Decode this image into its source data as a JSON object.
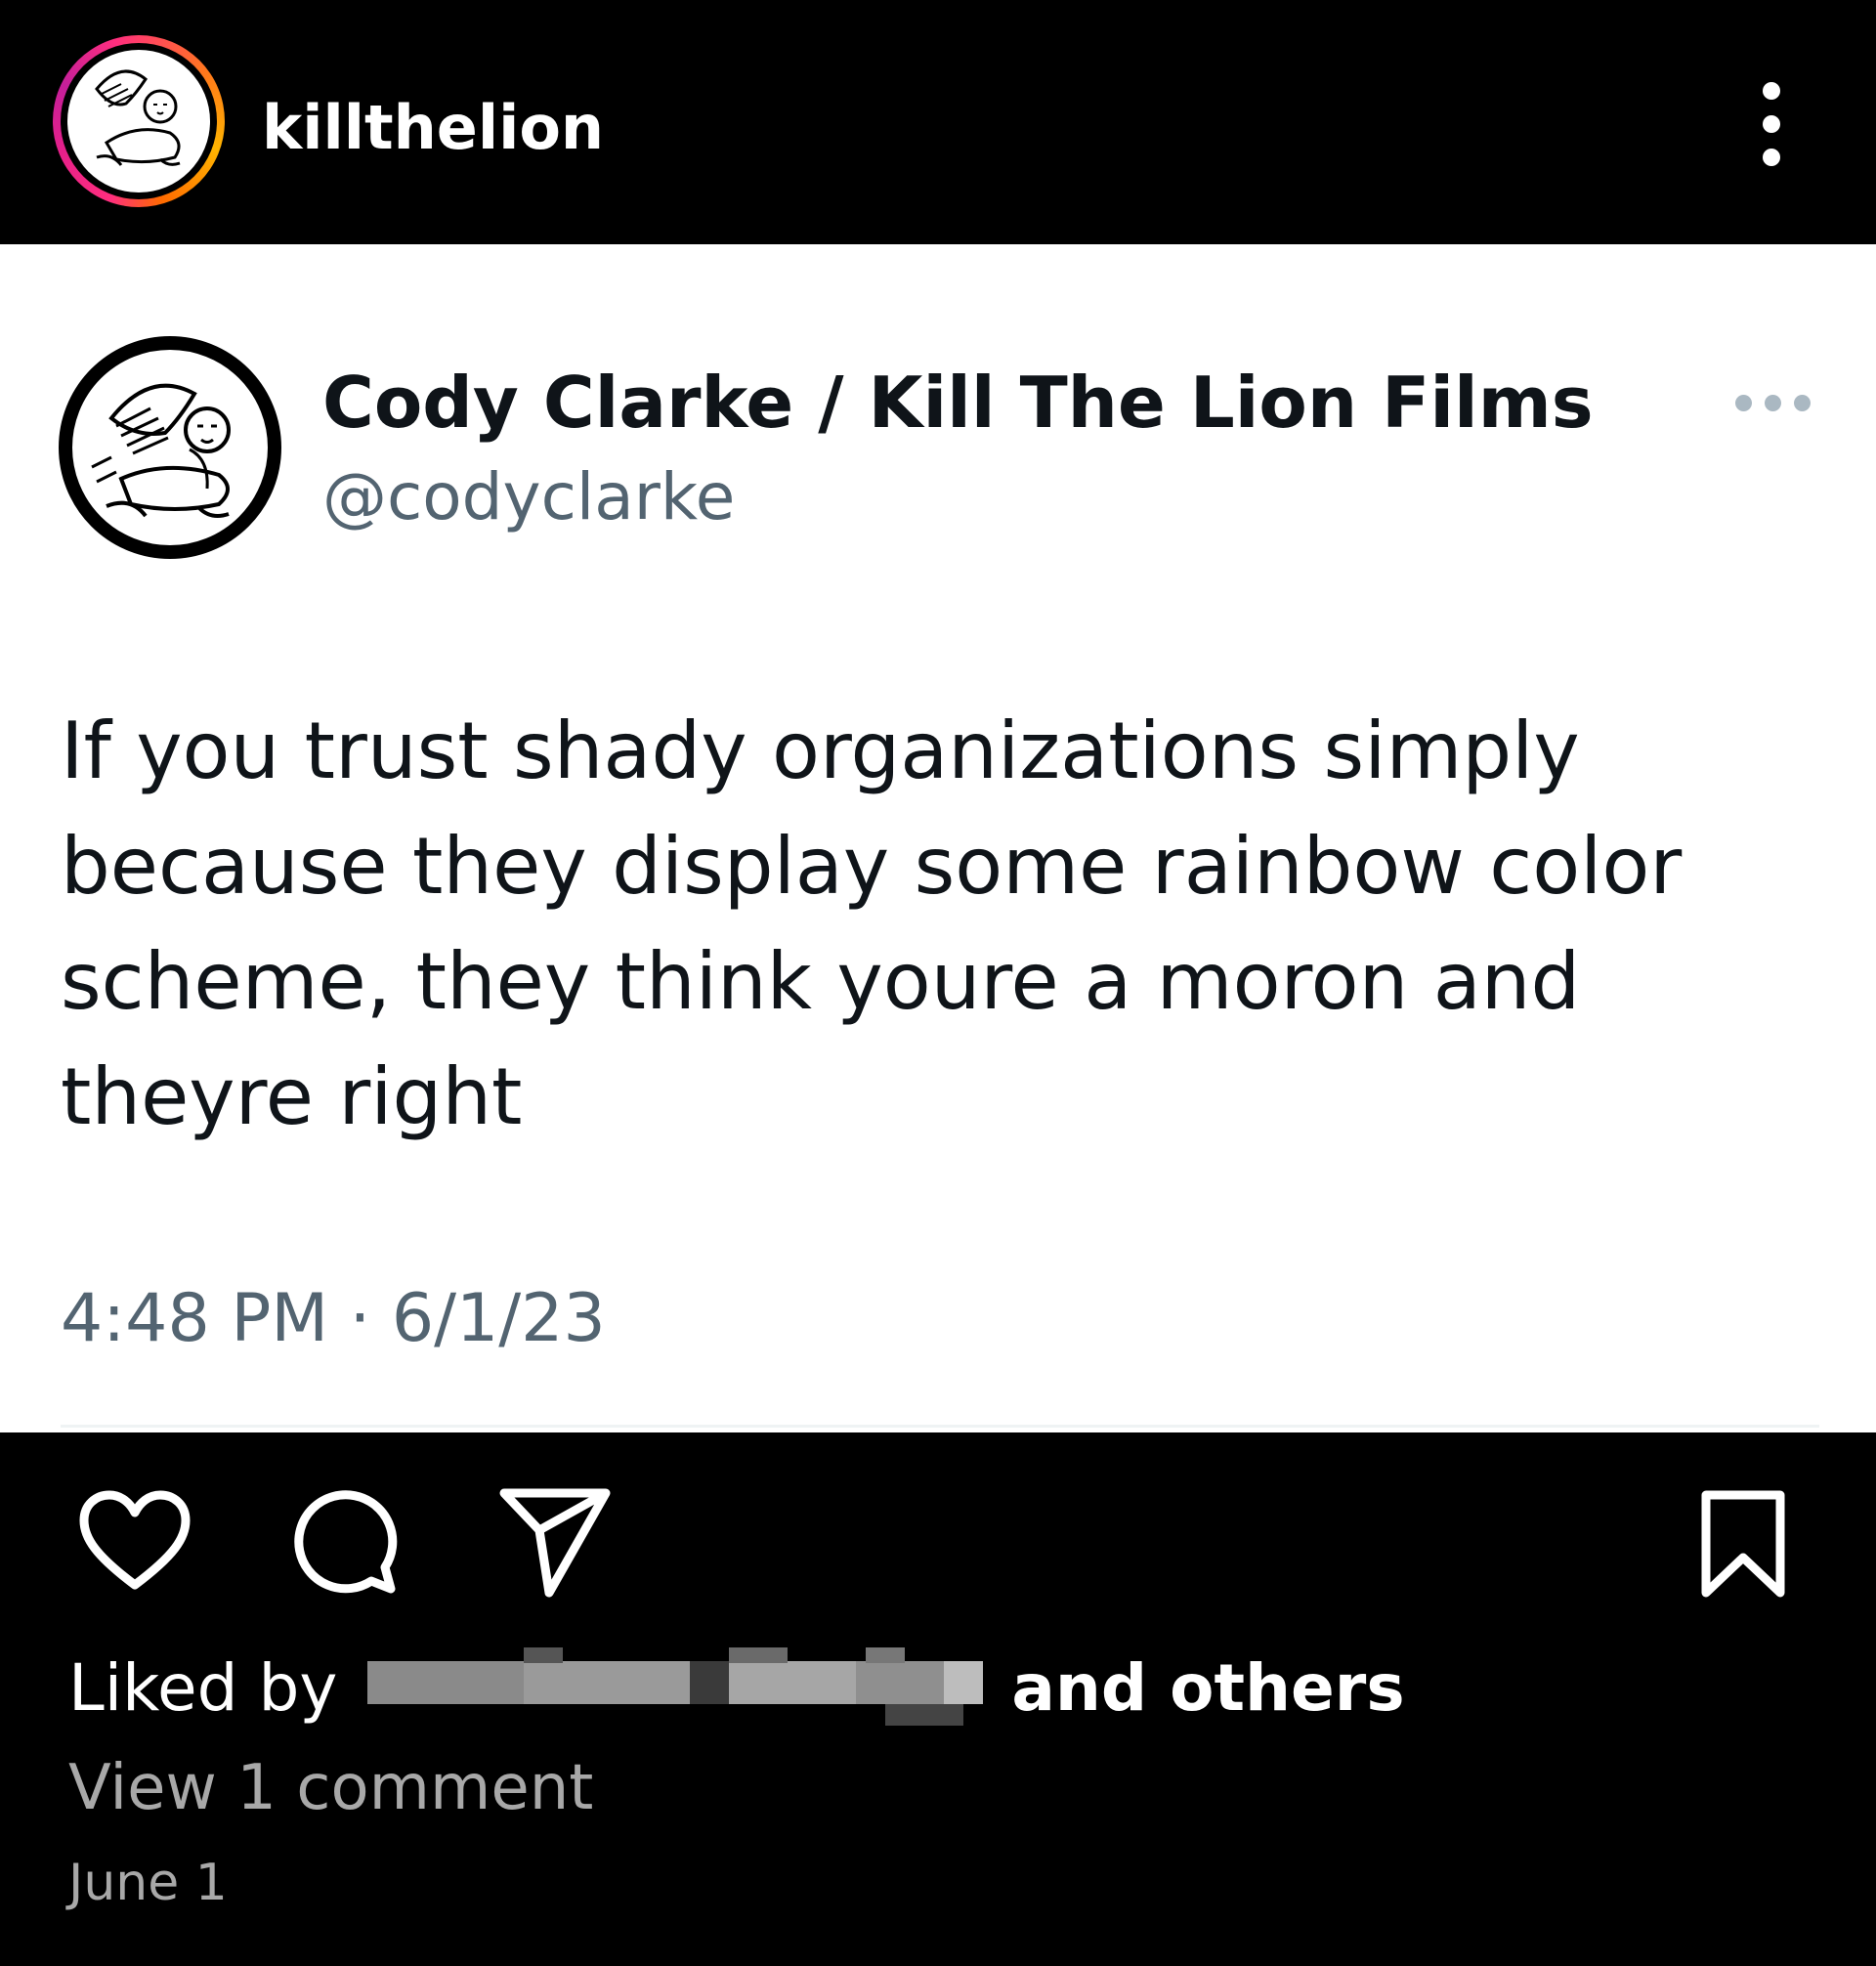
{
  "header": {
    "username": "killthelion"
  },
  "tweet": {
    "display_name": "Cody Clarke / Kill The Lion Films",
    "handle": "@codyclarke",
    "text": "If you trust shady organizations simply because they display some rainbow color scheme, they think youre a moron and theyre right",
    "timestamp": "4:48 PM · 6/1/23"
  },
  "footer": {
    "liked_prefix": "Liked by",
    "liked_suffix": "and others",
    "view_comments": "View 1 comment",
    "date": "June 1"
  },
  "icons": {
    "avatar": "winged-lion-logo",
    "menu": "more-vertical-icon",
    "tweet_menu": "more-horizontal-icon",
    "like": "heart-icon",
    "comment": "comment-icon",
    "share": "send-icon",
    "save": "bookmark-icon"
  },
  "colors": {
    "instagram_bg": "#000000",
    "tweet_bg": "#ffffff",
    "tweet_text": "#0f1419",
    "tweet_secondary": "#536471",
    "muted_text": "#a8a8a8"
  }
}
